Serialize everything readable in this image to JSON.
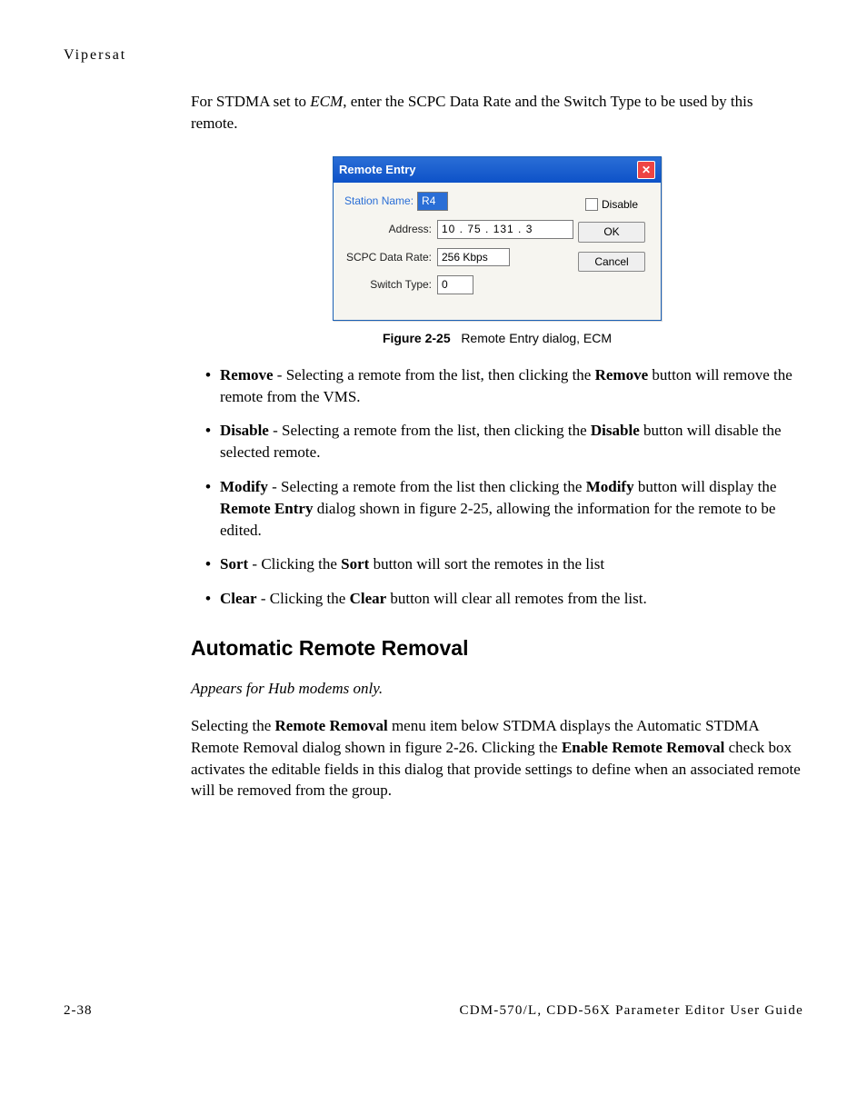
{
  "running_head": "Vipersat",
  "intro_pre": "For STDMA set to ",
  "intro_em": "ECM",
  "intro_post": ", enter the SCPC Data Rate and the Switch Type to be used by this remote.",
  "dialog": {
    "title": "Remote Entry",
    "station_label": "Station Name:",
    "station_value": "R4",
    "address_label": "Address:",
    "address_value": "10  .  75  . 131  .   3",
    "rate_label": "SCPC Data Rate:",
    "rate_value": "256 Kbps",
    "type_label": "Switch Type:",
    "type_value": "0",
    "disable_label": "Disable",
    "ok": "OK",
    "cancel": "Cancel"
  },
  "figcaption_num": "Figure 2-25",
  "figcaption_text": "Remote Entry dialog, ECM",
  "bullets": {
    "remove_b": "Remove",
    "remove_t1": " - Selecting a remote from the list, then clicking the ",
    "remove_b2": "Remove",
    "remove_t2": " button will remove the remote from the VMS.",
    "disable_b": "Disable",
    "disable_t1": " - Selecting a remote from the list, then clicking the ",
    "disable_b2": "Disable",
    "disable_t2": " button will disable the selected remote.",
    "modify_b": "Modify",
    "modify_t1": " - Selecting a remote from the list then clicking the ",
    "modify_b2": "Modify",
    "modify_t2": " button will display the ",
    "modify_b3": "Remote Entry",
    "modify_t3": " dialog shown in figure 2-25, allowing the information for the remote to be edited.",
    "sort_b": "Sort",
    "sort_t1": " - Clicking the ",
    "sort_b2": "Sort",
    "sort_t2": " button will sort the remotes in the list",
    "clear_b": "Clear",
    "clear_t1": " - Clicking the ",
    "clear_b2": "Clear",
    "clear_t2": " button will clear all remotes from the list."
  },
  "section_heading": "Automatic Remote Removal",
  "subnote": "Appears for Hub modems only.",
  "para_t1": "Selecting the ",
  "para_b1": "Remote Removal",
  "para_t2": " menu item below STDMA displays the Automatic STDMA Remote Removal dialog shown in figure 2-26. Clicking the ",
  "para_b2": "Enable Remote Removal",
  "para_t3": " check box activates the editable fields in this dialog that provide settings to define when an associated remote will be removed from the group.",
  "footer_left": "2-38",
  "footer_right": "CDM-570/L, CDD-56X Parameter Editor User Guide"
}
